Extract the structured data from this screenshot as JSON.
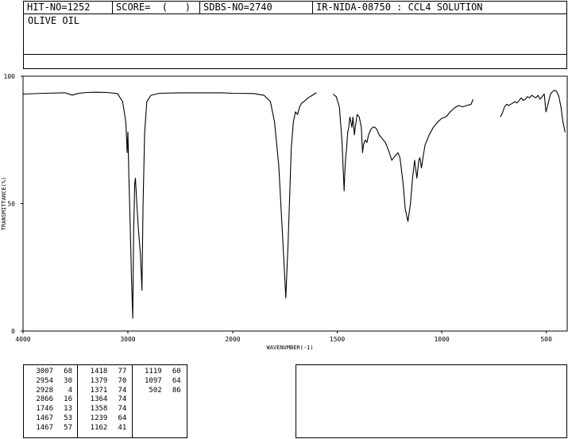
{
  "header": {
    "hit_no": "HIT-NO=1252",
    "score": "SCORE=  (   )",
    "sdbs_no": "SDBS-NO=2740",
    "ir_code": "IR-NIDA-08750 : CCL4 SOLUTION"
  },
  "sample_name": "OLIVE OIL",
  "chart_data": {
    "type": "line",
    "xlabel": "WAVENUMBER(-1)",
    "ylabel": "TRANSMITTANCE(%)",
    "xlim": [
      4000,
      400
    ],
    "ylim": [
      0,
      100
    ],
    "x_ticks": [
      "4000",
      "3000",
      "2000",
      "1500",
      "1000",
      "500"
    ],
    "y_ticks": [
      "100",
      "50",
      "0"
    ],
    "grid": false,
    "color": "#000000",
    "series": [
      {
        "points": [
          [
            4000,
            93
          ],
          [
            3800,
            93.3
          ],
          [
            3600,
            93.5
          ],
          [
            3530,
            92.6
          ],
          [
            3480,
            93.2
          ],
          [
            3400,
            93.6
          ],
          [
            3300,
            93.7
          ],
          [
            3200,
            93.6
          ],
          [
            3100,
            93.2
          ],
          [
            3050,
            90
          ],
          [
            3020,
            82
          ],
          [
            3007,
            70
          ],
          [
            3000,
            78
          ],
          [
            2990,
            60
          ],
          [
            2980,
            45
          ],
          [
            2965,
            20
          ],
          [
            2954,
            5
          ],
          [
            2945,
            40
          ],
          [
            2935,
            58
          ],
          [
            2928,
            60
          ],
          [
            2915,
            50
          ],
          [
            2900,
            40
          ],
          [
            2880,
            30
          ],
          [
            2866,
            16
          ],
          [
            2855,
            50
          ],
          [
            2840,
            78
          ],
          [
            2820,
            90
          ],
          [
            2780,
            92.5
          ],
          [
            2700,
            93.3
          ],
          [
            2500,
            93.5
          ],
          [
            2300,
            93.5
          ],
          [
            2100,
            93.5
          ],
          [
            2000,
            93.3
          ],
          [
            1900,
            93.2
          ],
          [
            1850,
            92.5
          ],
          [
            1820,
            90
          ],
          [
            1800,
            82
          ],
          [
            1780,
            65
          ],
          [
            1760,
            35
          ],
          [
            1746,
            13
          ],
          [
            1735,
            35
          ],
          [
            1720,
            72
          ],
          [
            1710,
            82
          ],
          [
            1700,
            86
          ],
          [
            1690,
            85
          ],
          [
            1680,
            88
          ],
          [
            1670,
            89.5
          ],
          [
            1660,
            90
          ],
          [
            1640,
            91.5
          ],
          [
            1620,
            92.5
          ],
          [
            1600,
            93.5
          ],
          null,
          [
            1520,
            93
          ],
          [
            1505,
            92
          ],
          [
            1490,
            88
          ],
          [
            1478,
            75
          ],
          [
            1470,
            60
          ],
          [
            1467,
            55
          ],
          [
            1464,
            62
          ],
          [
            1460,
            68
          ],
          [
            1455,
            72
          ],
          [
            1450,
            78
          ],
          [
            1445,
            80
          ],
          [
            1440,
            84
          ],
          [
            1435,
            82
          ],
          [
            1430,
            80
          ],
          [
            1425,
            84
          ],
          [
            1418,
            77
          ],
          [
            1414,
            80
          ],
          [
            1410,
            82
          ],
          [
            1405,
            85
          ],
          [
            1395,
            84
          ],
          [
            1385,
            80
          ],
          [
            1379,
            70
          ],
          [
            1375,
            73
          ],
          [
            1371,
            74
          ],
          [
            1366,
            75
          ],
          [
            1358,
            74
          ],
          [
            1350,
            77
          ],
          [
            1340,
            79
          ],
          [
            1330,
            80
          ],
          [
            1320,
            80
          ],
          [
            1310,
            79
          ],
          [
            1300,
            77
          ],
          [
            1290,
            76
          ],
          [
            1280,
            75
          ],
          [
            1270,
            74
          ],
          [
            1255,
            71
          ],
          [
            1239,
            67
          ],
          [
            1230,
            68
          ],
          [
            1220,
            69
          ],
          [
            1210,
            70
          ],
          [
            1200,
            68
          ],
          [
            1185,
            58
          ],
          [
            1175,
            48
          ],
          [
            1162,
            43
          ],
          [
            1150,
            50
          ],
          [
            1140,
            60
          ],
          [
            1130,
            67
          ],
          [
            1119,
            60
          ],
          [
            1110,
            67
          ],
          [
            1105,
            68
          ],
          [
            1097,
            64
          ],
          [
            1090,
            68
          ],
          [
            1080,
            73
          ],
          [
            1060,
            77
          ],
          [
            1040,
            80
          ],
          [
            1020,
            82
          ],
          [
            1000,
            83.5
          ],
          [
            980,
            84
          ],
          [
            960,
            86
          ],
          [
            940,
            87.5
          ],
          [
            920,
            88.5
          ],
          [
            900,
            88
          ],
          [
            880,
            88.5
          ],
          [
            860,
            89
          ],
          [
            850,
            91
          ],
          null,
          [
            720,
            84
          ],
          [
            710,
            85.5
          ],
          [
            700,
            88
          ],
          [
            690,
            89
          ],
          [
            680,
            88.5
          ],
          [
            670,
            89
          ],
          [
            660,
            89.5
          ],
          [
            650,
            90
          ],
          [
            640,
            89.5
          ],
          [
            630,
            90.5
          ],
          [
            620,
            91.5
          ],
          [
            610,
            90.5
          ],
          [
            600,
            91
          ],
          [
            590,
            92
          ],
          [
            580,
            91.5
          ],
          [
            570,
            92.5
          ],
          [
            560,
            92
          ],
          [
            550,
            91.5
          ],
          [
            540,
            92.5
          ],
          [
            530,
            91
          ],
          [
            520,
            92
          ],
          [
            510,
            93
          ],
          [
            502,
            86
          ],
          [
            495,
            88
          ],
          [
            480,
            93
          ],
          [
            470,
            94
          ],
          [
            460,
            94.5
          ],
          [
            450,
            94
          ],
          [
            440,
            92
          ],
          [
            430,
            88
          ],
          [
            420,
            82
          ],
          [
            410,
            78
          ]
        ]
      }
    ]
  },
  "peak_table": {
    "columns": [
      [
        [
          "3007",
          "68"
        ],
        [
          "2954",
          "30"
        ],
        [
          "2928",
          "4"
        ],
        [
          "2866",
          "16"
        ],
        [
          "1746",
          "13"
        ],
        [
          "1467",
          "53"
        ],
        [
          "1467",
          "57"
        ]
      ],
      [
        [
          "1418",
          "77"
        ],
        [
          "1379",
          "70"
        ],
        [
          "1371",
          "74"
        ],
        [
          "1364",
          "74"
        ],
        [
          "1358",
          "74"
        ],
        [
          "1239",
          "64"
        ],
        [
          "1162",
          "41"
        ]
      ],
      [
        [
          "1119",
          "60"
        ],
        [
          "1097",
          "64"
        ],
        [
          "502",
          "86"
        ]
      ]
    ]
  }
}
